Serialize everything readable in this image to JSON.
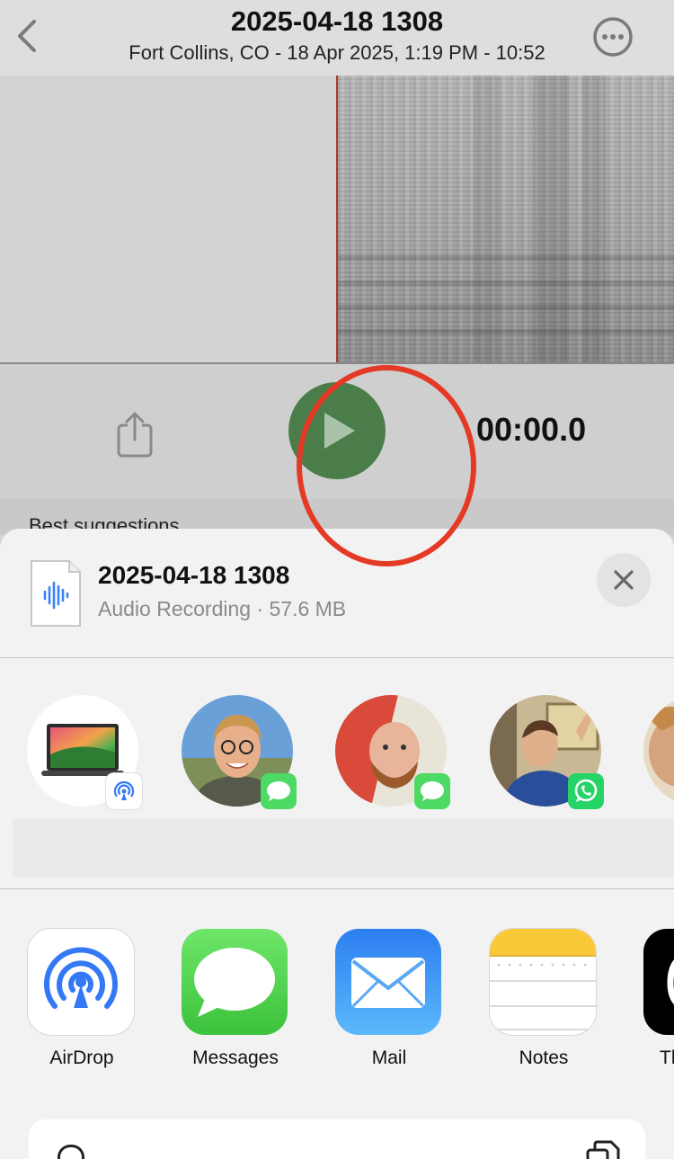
{
  "header": {
    "title": "2025-04-18 1308",
    "subtitle": "Fort Collins, CO - 18 Apr 2025, 1:19 PM - 10:52"
  },
  "player": {
    "timer": "00:00.0",
    "section_heading_partial": "Best suggestions"
  },
  "share_sheet": {
    "file": {
      "name": "2025-04-18 1308",
      "meta": "Audio Recording · 57.6 MB"
    },
    "people": [
      {
        "type": "device",
        "badge": "airdrop-icon"
      },
      {
        "type": "contact",
        "badge": "messages-icon"
      },
      {
        "type": "contact",
        "badge": "messages-icon"
      },
      {
        "type": "contact",
        "badge": "whatsapp-icon"
      },
      {
        "type": "contact",
        "badge": ""
      }
    ],
    "apps": [
      {
        "label": "AirDrop",
        "icon": "airdrop-icon"
      },
      {
        "label": "Messages",
        "icon": "messages-icon"
      },
      {
        "label": "Mail",
        "icon": "mail-icon",
        "highlighted": true
      },
      {
        "label": "Notes",
        "icon": "notes-icon"
      },
      {
        "label": "Th",
        "icon": "threads-icon"
      }
    ]
  },
  "colors": {
    "play_button": "#4b7d4b",
    "highlight_ring": "#e43a25",
    "playhead": "#b0352a",
    "messages_green": "#4cd964",
    "mail_blue": "#2f8df5",
    "whatsapp_green": "#25d366"
  }
}
